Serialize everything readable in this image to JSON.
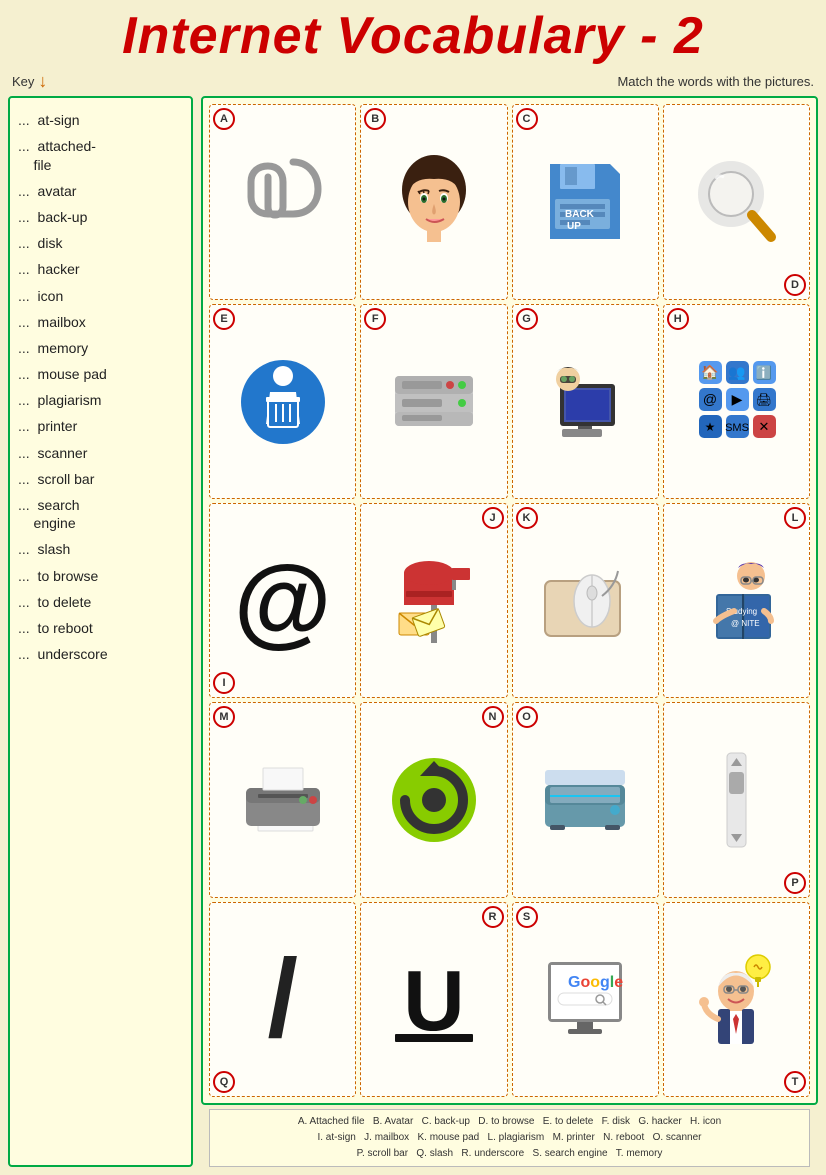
{
  "title": "Internet Vocabulary - 2",
  "key_label": "Key",
  "instruction": "Match the words with the pictures.",
  "vocab_items": [
    "at-sign",
    "attached-file",
    "avatar",
    "back-up",
    "disk",
    "hacker",
    "icon",
    "mailbox",
    "memory",
    "mouse pad",
    "plagiarism",
    "printer",
    "scanner",
    "scroll bar",
    "search engine",
    "slash",
    "to browse",
    "to delete",
    "to reboot",
    "underscore"
  ],
  "letters": [
    "A",
    "B",
    "C",
    "D",
    "E",
    "F",
    "G",
    "H",
    "I",
    "J",
    "K",
    "L",
    "M",
    "N",
    "O",
    "P",
    "Q",
    "R",
    "S",
    "T"
  ],
  "caption": "A. Attached file  B. Avatar  C. back-up  D. to browse  E. to delete  F. disk  G. hacker  H. icon\nI. at-sign  J. mailbox  K. mouse pad  L. plagiarism  M. printer  N. reboot  O. scanner\nP. scroll bar  Q. slash  R. underscore  S. search engine  T. memory"
}
